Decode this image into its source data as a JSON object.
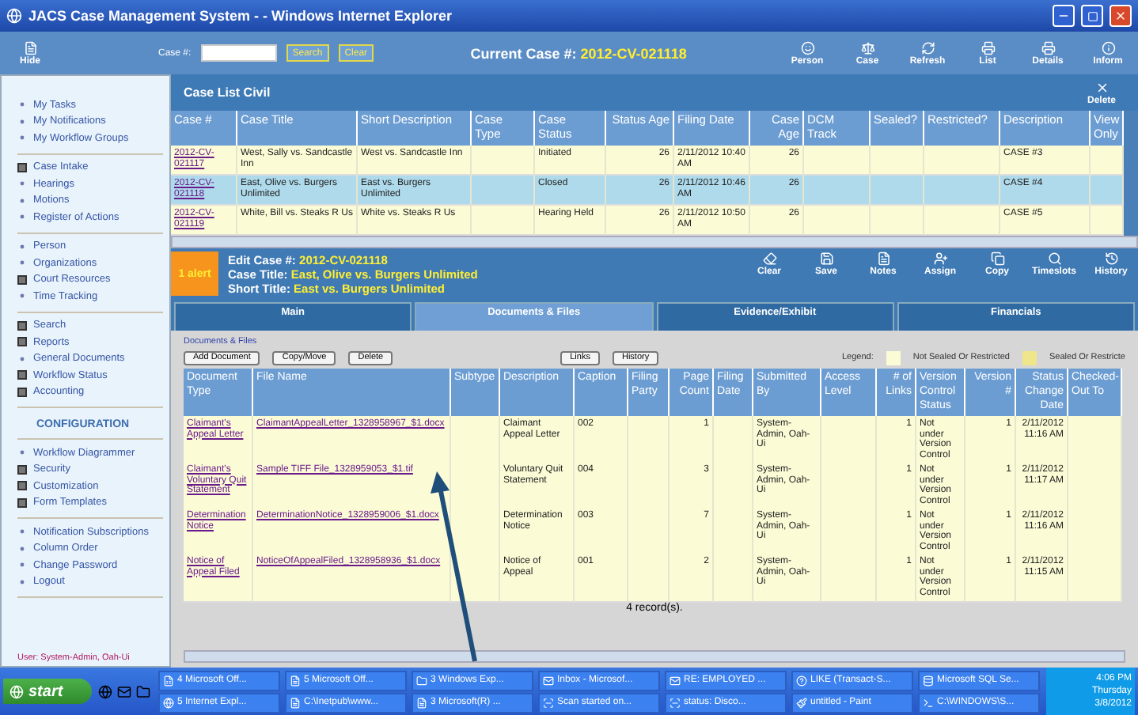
{
  "window": {
    "title": "JACS Case Management System - - Windows Internet Explorer"
  },
  "toolbar": {
    "hide_label": "Hide",
    "case_label": "Case #:",
    "buttons": [
      "Search",
      "Clear"
    ],
    "current_case_label": "Current Case #:",
    "current_case": "2012-CV-021118",
    "actions": [
      {
        "kind": "person",
        "label": "Person"
      },
      {
        "kind": "case",
        "label": "Case"
      },
      {
        "kind": "refresh",
        "label": "Refresh"
      },
      {
        "kind": "list",
        "label": "List"
      },
      {
        "kind": "details",
        "label": "Details"
      },
      {
        "kind": "info",
        "label": "Inform"
      }
    ]
  },
  "sidebar": {
    "groups": [
      {
        "items": [
          {
            "label": "My Tasks",
            "expandable": false
          },
          {
            "label": "My Notifications",
            "expandable": false
          },
          {
            "label": "My Workflow Groups",
            "expandable": false
          }
        ]
      },
      {
        "items": [
          {
            "label": "Case Intake",
            "expandable": true
          },
          {
            "label": "Hearings",
            "expandable": false
          },
          {
            "label": "Motions",
            "expandable": false
          },
          {
            "label": "Register of Actions",
            "expandable": false
          }
        ]
      },
      {
        "items": [
          {
            "label": "Person",
            "expandable": false
          },
          {
            "label": "Organizations",
            "expandable": false
          },
          {
            "label": "Court Resources",
            "expandable": true
          },
          {
            "label": "Time Tracking",
            "expandable": false
          }
        ]
      },
      {
        "items": [
          {
            "label": "Search",
            "expandable": true
          },
          {
            "label": "Reports",
            "expandable": true
          },
          {
            "label": "General Documents",
            "expandable": false
          },
          {
            "label": "Workflow Status",
            "expandable": true
          },
          {
            "label": "Accounting",
            "expandable": true
          }
        ]
      },
      {
        "heading": "CONFIGURATION",
        "items": [
          {
            "label": "Workflow Diagrammer",
            "expandable": false
          },
          {
            "label": "Security",
            "expandable": true
          },
          {
            "label": "Customization",
            "expandable": true
          },
          {
            "label": "Form Templates",
            "expandable": true
          }
        ]
      },
      {
        "items": [
          {
            "label": "Notification Subscriptions",
            "expandable": false
          },
          {
            "label": "Column Order",
            "expandable": false
          },
          {
            "label": "Change Password",
            "expandable": false
          },
          {
            "label": "Logout",
            "expandable": false
          }
        ]
      }
    ],
    "user": "User: System-Admin, Oah-Ui"
  },
  "case_list": {
    "title": "Case List Civil",
    "delete_label": "Delete",
    "columns": [
      "Case #",
      "Case Title",
      "Short Description",
      "Case Type",
      "Case Status",
      "Status Age",
      "Filing Date",
      "Case Age",
      "DCM Track",
      "Sealed?",
      "Restricted?",
      "Description",
      "View Only"
    ],
    "rows": [
      {
        "selected": false,
        "cells": [
          "2012-CV-021117",
          "West, Sally vs. Sandcastle Inn",
          "West vs. Sandcastle Inn",
          "",
          "Initiated",
          "26",
          "2/11/2012 10:40 AM",
          "26",
          "",
          "",
          "",
          "CASE #3",
          ""
        ]
      },
      {
        "selected": true,
        "cells": [
          "2012-CV-021118",
          "East, Olive vs. Burgers Unlimited",
          "East vs. Burgers Unlimited",
          "",
          "Closed",
          "26",
          "2/11/2012 10:46 AM",
          "26",
          "",
          "",
          "",
          "CASE #4",
          ""
        ]
      },
      {
        "selected": false,
        "cells": [
          "2012-CV-021119",
          "White, Bill vs. Steaks R Us",
          "White vs. Steaks R Us",
          "",
          "Hearing Held",
          "26",
          "2/11/2012 10:50 AM",
          "26",
          "",
          "",
          "",
          "CASE #5",
          ""
        ]
      }
    ]
  },
  "edit_case": {
    "alert": "1 alert",
    "fields": [
      {
        "label": "Edit Case #:",
        "value": "2012-CV-021118"
      },
      {
        "label": "Case Title:",
        "value": "East, Olive vs. Burgers Unlimited"
      },
      {
        "label": "Short Title:",
        "value": "East vs. Burgers Unlimited"
      }
    ],
    "actions": [
      {
        "kind": "clear",
        "label": "Clear"
      },
      {
        "kind": "save",
        "label": "Save"
      },
      {
        "kind": "notes",
        "label": "Notes"
      },
      {
        "kind": "assign",
        "label": "Assign"
      },
      {
        "kind": "copy",
        "label": "Copy"
      },
      {
        "kind": "timeslots",
        "label": "Timeslots"
      },
      {
        "kind": "history",
        "label": "History"
      }
    ]
  },
  "tabs": [
    {
      "label": "Main",
      "selected": false
    },
    {
      "label": "Documents & Files",
      "selected": true
    },
    {
      "label": "Evidence/Exhibit",
      "selected": false
    },
    {
      "label": "Financials",
      "selected": false
    }
  ],
  "documents": {
    "section_label": "Documents & Files",
    "buttons": [
      "Add Document",
      "Copy/Move",
      "Delete"
    ],
    "buttons_right": [
      "Links",
      "History"
    ],
    "legend_label": "Legend:",
    "legend": [
      {
        "label": "Not Sealed Or Restricted",
        "color": "#fbfbd6"
      },
      {
        "label": "Sealed Or Restricte",
        "color": "#efe58a"
      }
    ],
    "columns": [
      "Document Type",
      "File Name",
      "Subtype",
      "Description",
      "Caption",
      "Filing Party",
      "Page Count",
      "Filing Date",
      "Submitted By",
      "Access Level",
      "# of Links",
      "Version Control Status",
      "Version #",
      "Status Change Date",
      "Checked-Out To"
    ],
    "rows": [
      {
        "cells": [
          "Claimant's Appeal Letter",
          "ClaimantAppealLetter_1328958967_$1.docx",
          "",
          "Claimant Appeal Letter",
          "002",
          "",
          "1",
          "",
          "System-Admin, Oah-Ui",
          "",
          "1",
          "Not under Version Control",
          "1",
          "2/11/2012 11:16 AM",
          ""
        ]
      },
      {
        "cells": [
          "Claimant's Voluntary Quit Statement",
          "Sample TIFF File_1328959053_$1.tif",
          "",
          "Voluntary Quit Statement",
          "004",
          "",
          "3",
          "",
          "System-Admin, Oah-Ui",
          "",
          "1",
          "Not under Version Control",
          "1",
          "2/11/2012 11:17 AM",
          ""
        ]
      },
      {
        "cells": [
          "Determination Notice",
          "DeterminationNotice_1328959006_$1.docx",
          "",
          "Determination Notice",
          "003",
          "",
          "7",
          "",
          "System-Admin, Oah-Ui",
          "",
          "1",
          "Not under Version Control",
          "1",
          "2/11/2012 11:16 AM",
          ""
        ]
      },
      {
        "cells": [
          "Notice of Appeal Filed",
          "NoticeOfAppealFiled_1328958936_$1.docx",
          "",
          "Notice of Appeal",
          "001",
          "",
          "2",
          "",
          "System-Admin, Oah-Ui",
          "",
          "1",
          "Not under Version Control",
          "1",
          "2/11/2012 11:15 AM",
          ""
        ]
      }
    ],
    "footer": "4 record(s)."
  },
  "taskbar": {
    "start": "start",
    "tasks": [
      {
        "kind": "excel",
        "label": "4 Microsoft Off..."
      },
      {
        "kind": "doc",
        "label": "5 Microsoft Off..."
      },
      {
        "kind": "folder",
        "label": "3 Windows Exp..."
      },
      {
        "kind": "mail",
        "label": "Inbox - Microsof..."
      },
      {
        "kind": "mail",
        "label": "RE: EMPLOYED ..."
      },
      {
        "kind": "query",
        "label": "LIKE (Transact-S..."
      },
      {
        "kind": "sql",
        "label": "Microsoft SQL Se..."
      },
      {
        "kind": "ie",
        "label": "5 Internet Expl..."
      },
      {
        "kind": "doc",
        "label": "C:\\Inetpub\\www..."
      },
      {
        "kind": "doc",
        "label": "3 Microsoft(R) ..."
      },
      {
        "kind": "scan",
        "label": "Scan started on..."
      },
      {
        "kind": "scan",
        "label": "status: Disco..."
      },
      {
        "kind": "paint",
        "label": "untitled - Paint"
      },
      {
        "kind": "cmd",
        "label": "C:\\WINDOWS\\S..."
      }
    ],
    "time": "4:06 PM",
    "day": "Thursday",
    "date": "3/8/2012"
  }
}
